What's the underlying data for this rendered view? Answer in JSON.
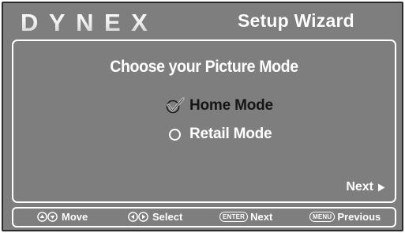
{
  "header": {
    "brand": "DYNEX",
    "title": "Setup Wizard"
  },
  "main": {
    "heading": "Choose your Picture Mode",
    "options": [
      {
        "label": "Home Mode",
        "selected": true,
        "icon": "check-icon"
      },
      {
        "label": "Retail Mode",
        "selected": false,
        "icon": "radio-circle-icon"
      }
    ],
    "next_label": "Next"
  },
  "footer": {
    "hints": [
      {
        "key_icons": [
          "up-arrow-circle-icon",
          "down-arrow-circle-icon"
        ],
        "label": "Move"
      },
      {
        "key_icons": [
          "left-arrow-circle-icon",
          "right-arrow-circle-icon"
        ],
        "label": "Select"
      },
      {
        "key": "ENTER",
        "label": "Next"
      },
      {
        "key": "MENU",
        "label": "Previous"
      }
    ]
  },
  "colors": {
    "background": "#7e7e7e",
    "text": "#ffffff",
    "selected_text": "#151515",
    "frame": "#2a2a2a"
  }
}
